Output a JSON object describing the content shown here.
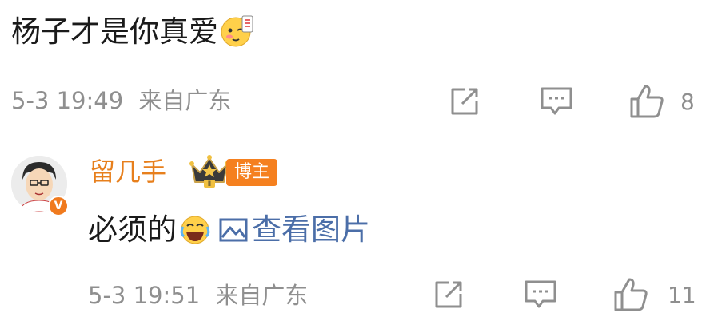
{
  "comment1": {
    "text": "杨子才是你真爱",
    "emoji_icon": "blush-emoji-icon",
    "timestamp": "5-3 19:49",
    "location": "来自广东",
    "like_count": "8"
  },
  "comment2": {
    "username": "留几手",
    "vip_badge": "V",
    "role_badge": "博主",
    "crown_level": "Ⅱ",
    "text": "必须的",
    "emoji_icon": "laugh-cry-emoji-icon",
    "image_link_label": "查看图片",
    "timestamp": "5-3 19:51",
    "location": "来自广东",
    "like_count": "11"
  },
  "colors": {
    "username": "#e77f1c",
    "badge": "#f5801f",
    "meta_gray": "#8f8f8f",
    "link_blue": "#4b6ea8"
  }
}
